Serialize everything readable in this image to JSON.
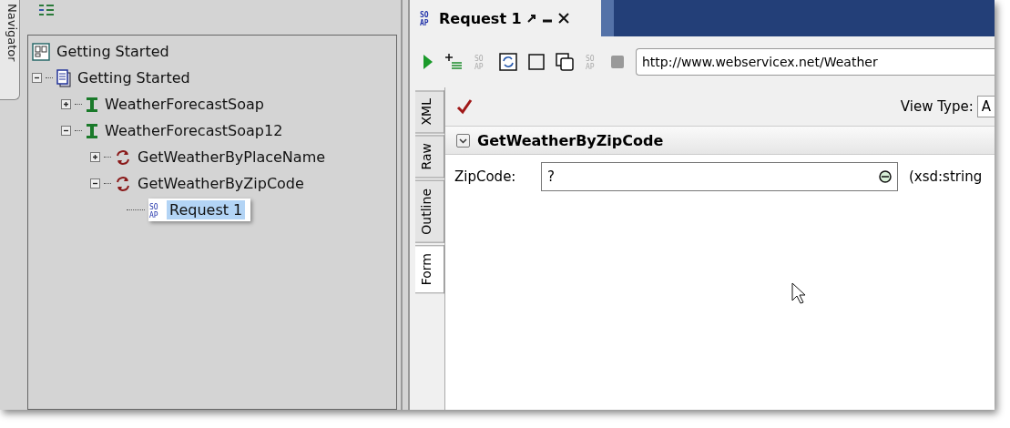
{
  "navigator_tab": {
    "label": "Navigator"
  },
  "tree": [
    {
      "label": "Getting Started",
      "kind": "workspace",
      "selected": false,
      "children": [
        {
          "label": "Getting Started",
          "kind": "project",
          "expanded": true,
          "selected": false,
          "children": [
            {
              "label": "WeatherForecastSoap",
              "kind": "interface",
              "expanded": false,
              "selected": false
            },
            {
              "label": "WeatherForecastSoap12",
              "kind": "interface",
              "expanded": true,
              "selected": false,
              "children": [
                {
                  "label": "GetWeatherByPlaceName",
                  "kind": "operation",
                  "expanded": false,
                  "selected": false
                },
                {
                  "label": "GetWeatherByZipCode",
                  "kind": "operation",
                  "expanded": true,
                  "selected": false,
                  "children": [
                    {
                      "label": "Request 1",
                      "kind": "request",
                      "selected": true,
                      "icon_text": [
                        "SO",
                        "AP"
                      ]
                    }
                  ]
                }
              ]
            }
          ]
        }
      ]
    }
  ],
  "editor_tab": {
    "title": "Request 1",
    "icon_text": [
      "SO",
      "AP"
    ]
  },
  "toolbar": [
    {
      "kind": "run"
    },
    {
      "kind": "add-step"
    },
    {
      "kind": "soap",
      "icon_text": [
        "SO",
        "AP"
      ],
      "disabled": true
    },
    {
      "kind": "refresh"
    },
    {
      "kind": "square"
    },
    {
      "kind": "copy"
    },
    {
      "kind": "soap",
      "icon_text": [
        "SO",
        "AP"
      ],
      "disabled": true
    },
    {
      "kind": "stop"
    }
  ],
  "endpoint": {
    "value": "http://www.webservicex.net/Weather"
  },
  "view_type": {
    "label": "View Type:",
    "value": "A"
  },
  "side_tabs": [
    {
      "label": "XML",
      "selected": false
    },
    {
      "label": "Raw",
      "selected": false
    },
    {
      "label": "Outline",
      "selected": false
    },
    {
      "label": "Form",
      "selected": true
    }
  ],
  "section": {
    "title": "GetWeatherByZipCode",
    "expanded": true
  },
  "fields": [
    {
      "label": "ZipCode:",
      "value": "?",
      "type": "(xsd:string"
    }
  ]
}
